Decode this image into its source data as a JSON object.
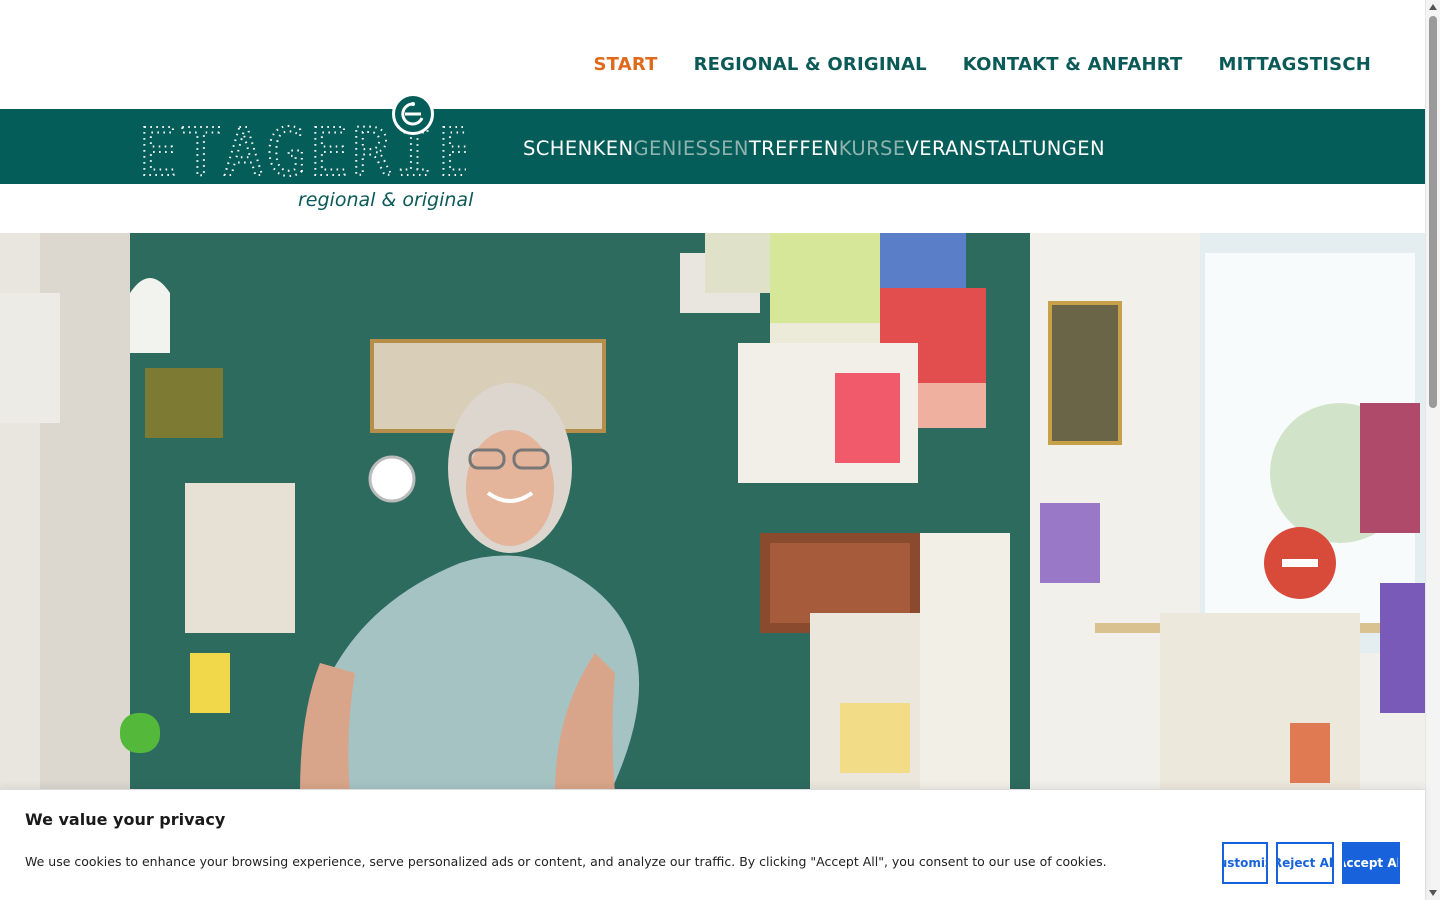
{
  "nav": {
    "items": [
      {
        "label": "START",
        "active": true
      },
      {
        "label": "REGIONAL & ORIGINAL",
        "active": false
      },
      {
        "label": "KONTAKT & ANFAHRT",
        "active": false
      },
      {
        "label": "MITTAGSTISCH",
        "active": false
      }
    ]
  },
  "brand": {
    "logo": "ETAGERIE",
    "tagline": "regional & original"
  },
  "subnav": {
    "items": [
      "SCHENKEN",
      "GENIESSEN",
      "TREFFEN",
      "KURSE",
      "VERANSTALTUNGEN"
    ]
  },
  "cookie": {
    "title": "We value your privacy",
    "text": "We use cookies to enhance your browsing experience, serve personalized ads or content, and analyze our traffic. By clicking \"Accept All\", you consent to our use of cookies.",
    "customize_label": "Customize",
    "reject_label": "Reject All",
    "accept_label": "Accept All"
  },
  "colors": {
    "brand_teal": "#055d5a",
    "nav_active": "#e06a1b",
    "cookie_blue": "#1863dc"
  }
}
